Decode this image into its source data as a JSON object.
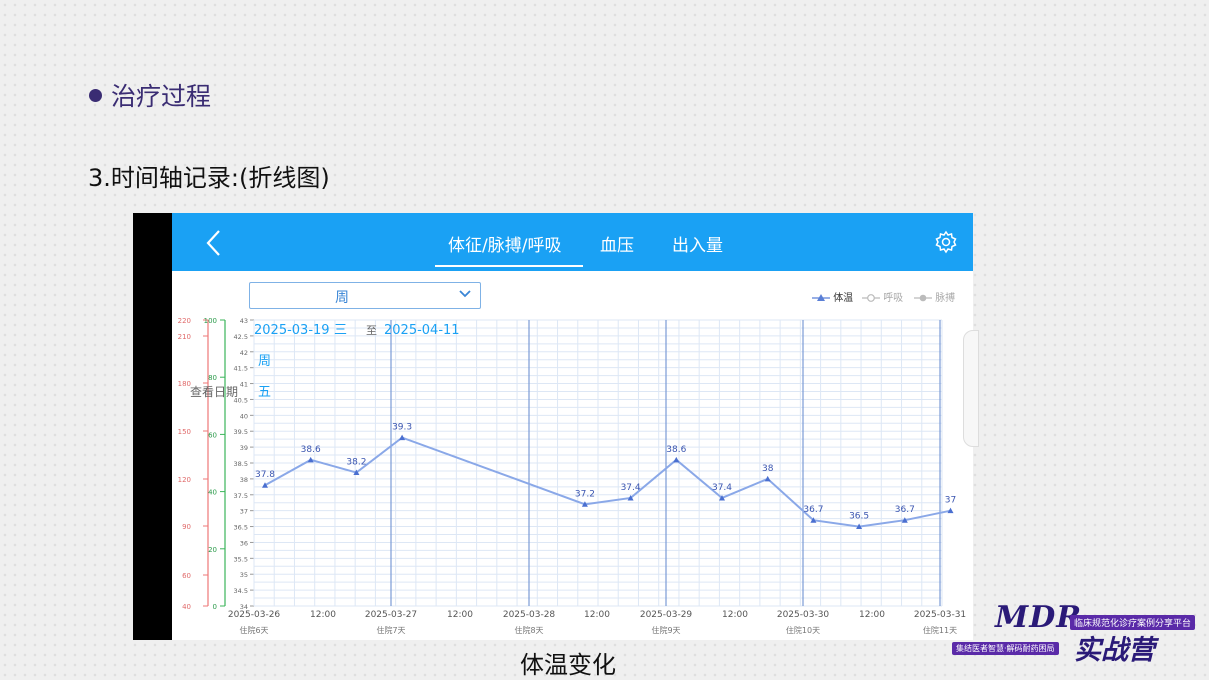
{
  "slide": {
    "section_title": "治疗过程",
    "subtitle": "3.时间轴记录:(折线图)",
    "caption": "体温变化"
  },
  "app": {
    "tabs": [
      {
        "label": "体征/脉搏/呼吸",
        "active": true
      },
      {
        "label": "血压",
        "active": false
      },
      {
        "label": "出入量",
        "active": false
      }
    ],
    "period_select": {
      "value": "周"
    },
    "date_range": {
      "start": "2025-03-19",
      "start_weekday": "三",
      "sep": "至",
      "end": "2025-04-11",
      "end_weekday": "五",
      "unit": "周"
    },
    "view_date_label": "查看日期",
    "legend": [
      {
        "label": "体温",
        "active": true
      },
      {
        "label": "呼吸",
        "active": false
      },
      {
        "label": "脉搏",
        "active": false
      }
    ],
    "accent_color": "#1aa1f4",
    "line_color": "#8aa8e8"
  },
  "chart_data": {
    "type": "line",
    "title": "",
    "series": [
      {
        "name": "体温",
        "x": [
          0,
          1,
          2,
          3,
          7,
          8,
          9,
          10,
          11,
          12,
          13,
          14,
          15
        ],
        "values": [
          37.8,
          38.6,
          38.2,
          39.3,
          37.2,
          37.4,
          38.6,
          37.4,
          38.0,
          36.7,
          36.5,
          36.7,
          37.0
        ]
      }
    ],
    "y_temp": {
      "ylim": [
        34,
        43
      ],
      "ticks": [
        "34",
        "34.5",
        "35",
        "35.5",
        "36",
        "36.5",
        "37",
        "37.5",
        "38",
        "38.5",
        "39",
        "39.5",
        "40",
        "40.5",
        "41",
        "41.5",
        "42",
        "42.5",
        "43"
      ]
    },
    "y_breath": {
      "ylim": [
        0,
        100
      ],
      "ticks": [
        "0",
        "20",
        "40",
        "60",
        "80",
        "100"
      ]
    },
    "y_pulse": {
      "ticks": [
        "40",
        "60",
        "90",
        "120",
        "150",
        "180",
        "210",
        "220"
      ]
    },
    "x_ticks": [
      {
        "label": "2025-03-26",
        "sub": "住院6天"
      },
      {
        "label": "12:00",
        "sub": ""
      },
      {
        "label": "2025-03-27",
        "sub": "住院7天"
      },
      {
        "label": "12:00",
        "sub": ""
      },
      {
        "label": "2025-03-28",
        "sub": "住院8天"
      },
      {
        "label": "12:00",
        "sub": ""
      },
      {
        "label": "2025-03-29",
        "sub": "住院9天"
      },
      {
        "label": "12:00",
        "sub": ""
      },
      {
        "label": "2025-03-30",
        "sub": "住院10天"
      },
      {
        "label": "12:00",
        "sub": ""
      },
      {
        "label": "2025-03-31",
        "sub": "住院11天"
      }
    ]
  },
  "logo": {
    "mark": "MDR",
    "tagline": "临床规范化诊疗案例分享平台",
    "slogan": "集结医者智慧·解码耐药困局",
    "camp": "实战营"
  }
}
